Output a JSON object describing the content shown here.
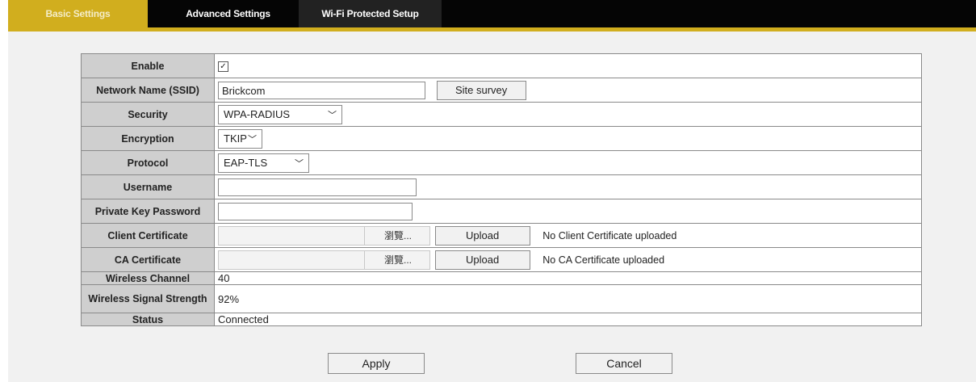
{
  "tabs": [
    "Basic Settings",
    "Advanced Settings",
    "Wi-Fi Protected Setup"
  ],
  "form": {
    "enable_label": "Enable",
    "enable_checked": true,
    "ssid_label": "Network Name (SSID)",
    "ssid_value": "Brickcom",
    "site_survey": "Site survey",
    "security_label": "Security",
    "security_value": "WPA-RADIUS",
    "encryption_label": "Encryption",
    "encryption_value": "TKIP",
    "protocol_label": "Protocol",
    "protocol_value": "EAP-TLS",
    "username_label": "Username",
    "username_value": "",
    "pkpw_label": "Private Key Password",
    "pkpw_value": "",
    "client_cert_label": "Client Certificate",
    "browse_label": "瀏覽...",
    "upload_label": "Upload",
    "client_cert_status": "No Client Certificate uploaded",
    "ca_cert_label": "CA Certificate",
    "ca_cert_status": "No CA Certificate uploaded",
    "channel_label": "Wireless Channel",
    "channel_value": "40",
    "signal_label": "Wireless Signal Strength",
    "signal_value": "92%",
    "status_label": "Status",
    "status_value": "Connected"
  },
  "actions": {
    "apply": "Apply",
    "cancel": "Cancel"
  }
}
